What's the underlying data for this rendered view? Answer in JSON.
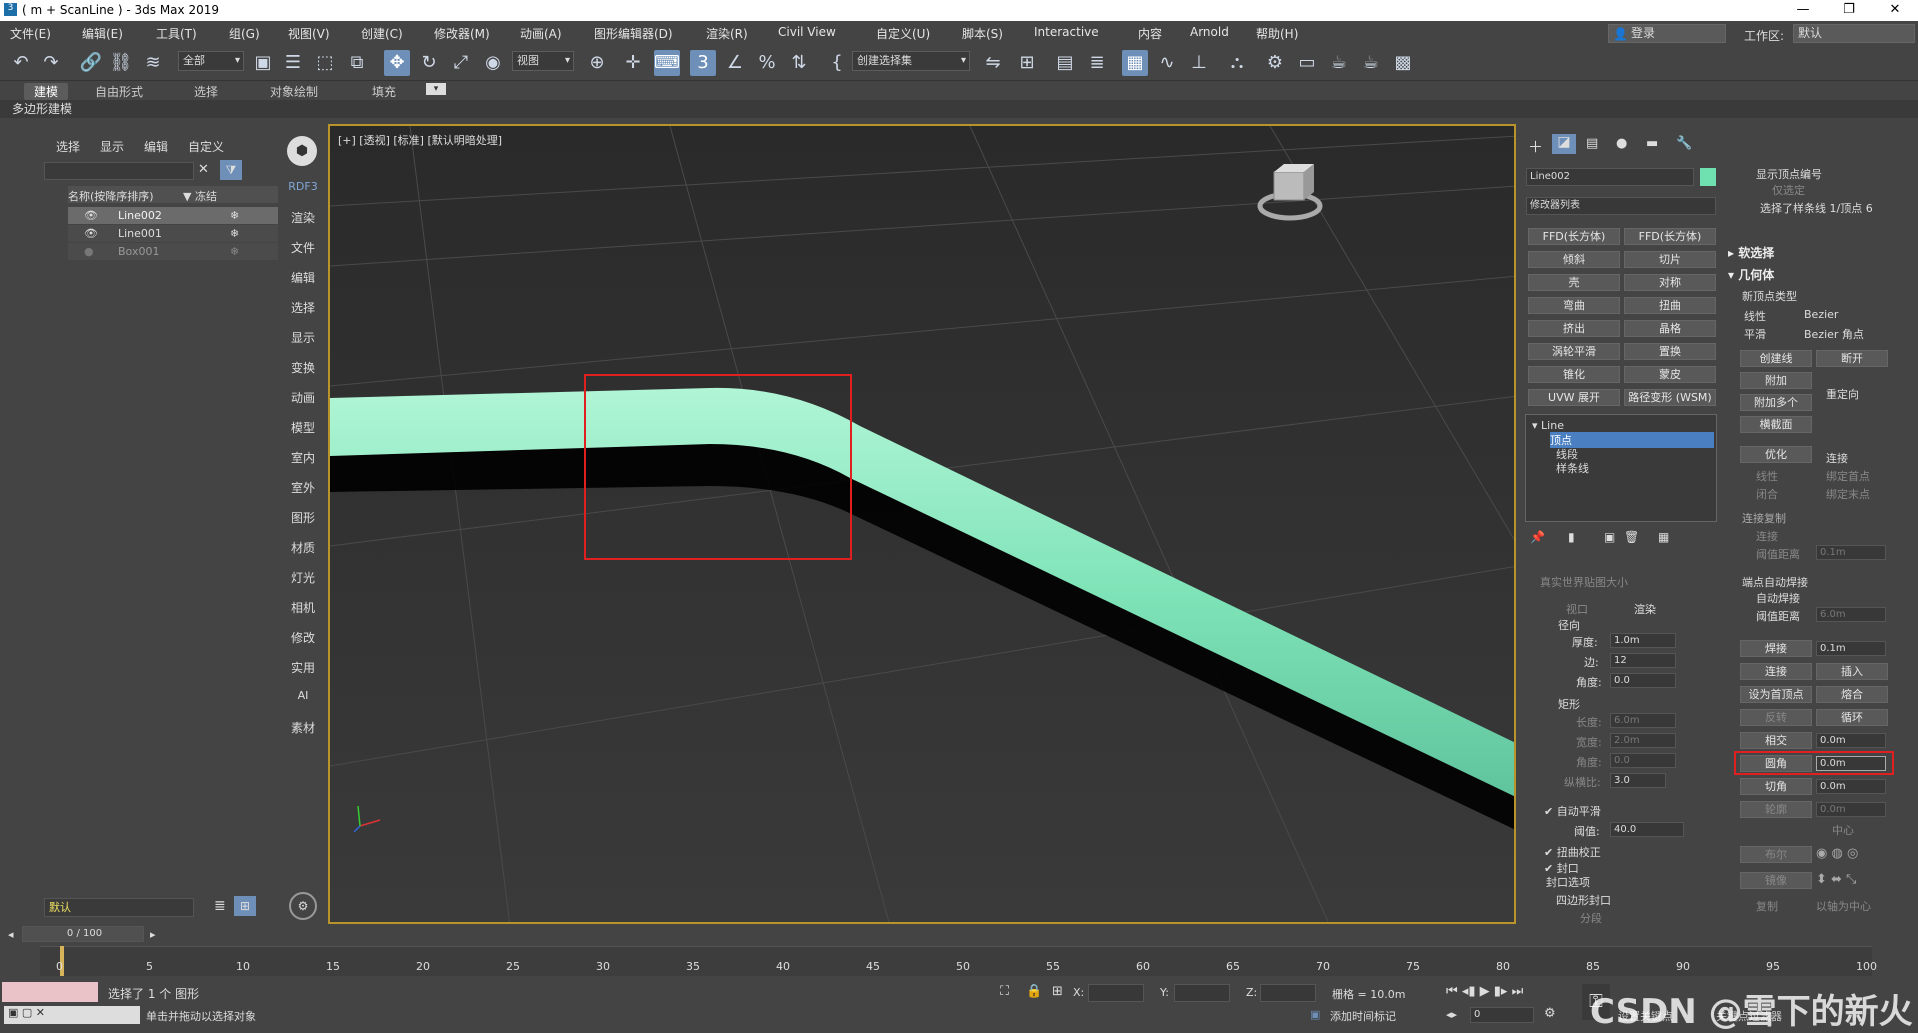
{
  "title": "( m + ScanLine ) - 3ds Max 2019",
  "window_buttons": [
    "—",
    "❐",
    "✕"
  ],
  "menu": [
    "文件(E)",
    "编辑(E)",
    "工具(T)",
    "组(G)",
    "视图(V)",
    "创建(C)",
    "修改器(M)",
    "动画(A)",
    "图形编辑器(D)",
    "渲染(R)",
    "Civil View",
    "自定义(U)",
    "脚本(S)",
    "Interactive",
    "内容",
    "Arnold",
    "帮助(H)"
  ],
  "login": "登录",
  "workspace_label": "工作区:",
  "workspace": "默认",
  "toolbar": {
    "selection_filter": "全部",
    "ref_coord": "视图",
    "named_sel": "创建选择集"
  },
  "ribbon_tabs": [
    "建模",
    "自由形式",
    "选择",
    "对象绘制",
    "填充"
  ],
  "ribbon_sub": "多边形建模",
  "scene": {
    "menu": [
      "选择",
      "显示",
      "编辑",
      "自定义"
    ],
    "col_name": "名称(按降序排序)",
    "col_freeze": "▼ 冻结",
    "rows": [
      "Line002",
      "Line001",
      "Box001"
    ],
    "layer": "默认"
  },
  "vp_side": [
    "RDF3",
    "渲染",
    "文件",
    "编辑",
    "选择",
    "显示",
    "变换",
    "动画",
    "模型",
    "室内",
    "室外",
    "图形",
    "材质",
    "灯光",
    "相机",
    "修改",
    "实用",
    "AI",
    "素材"
  ],
  "viewport_label": "[+] [透视] [标准] [默认明暗处理]",
  "cmd": {
    "object_name": "Line002",
    "modifier_list": "修改器列表",
    "mod_buttons": [
      "FFD(长方体)",
      "FFD(长方体)",
      "倾斜",
      "切片",
      "壳",
      "对称",
      "弯曲",
      "扭曲",
      "挤出",
      "晶格",
      "涡轮平滑",
      "置换",
      "锥化",
      "蒙皮",
      "UVW 展开",
      "路径变形 (WSM)"
    ],
    "stack": [
      "Line",
      "顶点",
      "线段",
      "样条线"
    ],
    "show_vertex_num": "显示顶点编号",
    "only_selected": "仅选定",
    "sel_status": "选择了样条线 1/顶点 6",
    "soft_sel": "软选择",
    "geometry": "几何体",
    "new_vertex_type": "新顶点类型",
    "vt": [
      "线性",
      "Bezier",
      "平滑",
      "Bezier 角点"
    ],
    "geo_btns": [
      "创建线",
      "断开",
      "附加",
      "附加多个",
      "横截面",
      "优化",
      "线性",
      "闭合"
    ],
    "reorient": "重定向",
    "connect": "连接",
    "bind_first": "绑定首点",
    "bind_last": "绑定末点",
    "conn_copy": "连接复制",
    "conn": "连接",
    "thresh_dist": "阈值距离",
    "thresh_val": "0.1m",
    "end_weld": "端点自动焊接",
    "auto_weld": "自动焊接",
    "weld_thresh": "阈值距离",
    "weld_val": "6.0m",
    "weld": "焊接",
    "weld_spin": "0.1m",
    "link": "连接",
    "insert": "插入",
    "set_first": "设为首顶点",
    "fuse": "熔合",
    "reverse": "反转",
    "cycle": "循环",
    "intersect": "相交",
    "intersect_val": "0.0m",
    "fillet": "圆角",
    "fillet_val": "0.0m",
    "chamfer": "切角",
    "chamfer_val": "0.0m",
    "outline": "轮廓",
    "outline_val": "0.0m",
    "center": "中心",
    "boolean": "布尔",
    "mirror": "镜像",
    "copy": "复制",
    "about_pivot": "以轴为中心",
    "real_world": "真实世界贴图大小",
    "viewport": "视口",
    "render": "渲染",
    "radial": "径向",
    "thickness": "厚度:",
    "thickness_val": "1.0m",
    "sides": "边:",
    "sides_val": "12",
    "angle": "角度:",
    "angle_val": "0.0",
    "rect": "矩形",
    "length": "长度:",
    "length_val": "6.0m",
    "width": "宽度:",
    "width_val": "2.0m",
    "angle2": "角度:",
    "angle2_val": "0.0",
    "aspect": "纵横比:",
    "aspect_val": "3.0",
    "auto_smooth": "自动平滑",
    "threshold": "阈值:",
    "threshold_val": "40.0",
    "twist": "扭曲校正",
    "cap": "封口",
    "cap_opts": "封口选项",
    "quad_cap": "四边形封口",
    "seg": "分段"
  },
  "time": {
    "frame": "0 / 100",
    "ticks": [
      "0",
      "5",
      "10",
      "15",
      "20",
      "25",
      "30",
      "35",
      "40",
      "45",
      "50",
      "55",
      "60",
      "65",
      "70",
      "75",
      "80",
      "85",
      "90",
      "95",
      "100"
    ]
  },
  "status": {
    "line1": "选择了 1 个 图形",
    "line2": "单击并拖动以选择对象",
    "x": "X:",
    "y": "Y:",
    "z": "Z:",
    "grid": "栅格 = 10.0m",
    "addtime": "添加时间标记",
    "frame_field": "0",
    "setkey": "设置关键点",
    "keyfilter": "关键点过滤器",
    "watermark": "CSDN @雪下的新火"
  }
}
